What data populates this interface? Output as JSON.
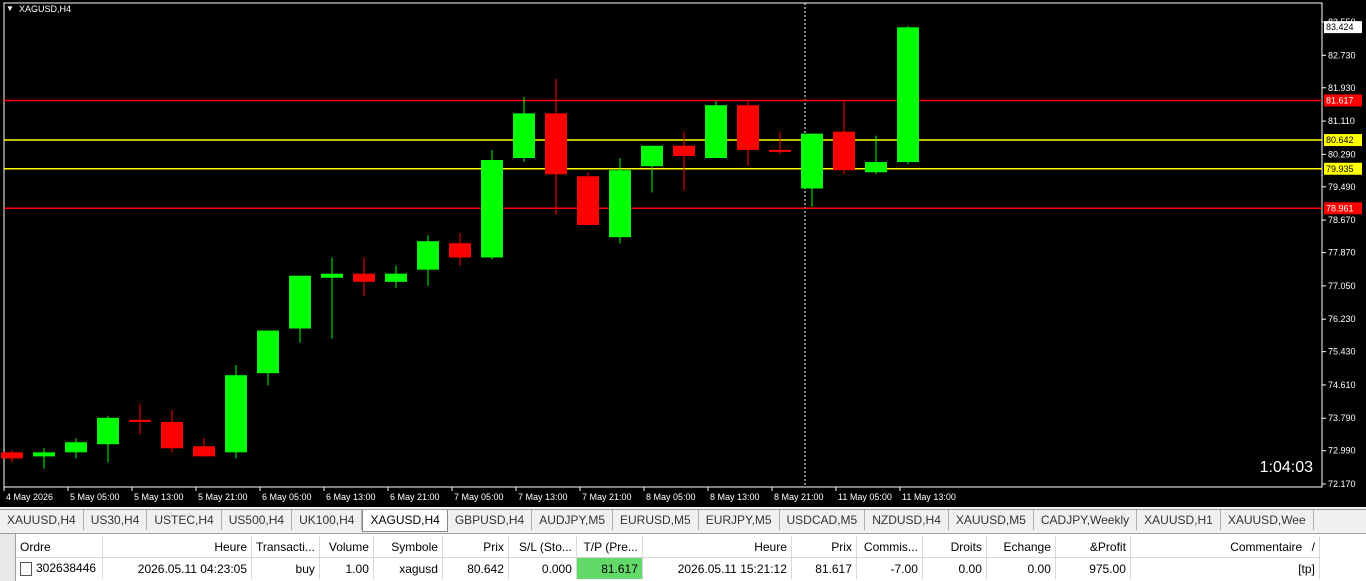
{
  "chart": {
    "title": "XAGUSD,H4",
    "countdown": "1:04:03",
    "price_labels": [
      "83.550",
      "83.424",
      "82.730",
      "81.930",
      "81.617",
      "81.110",
      "80.642",
      "80.290",
      "79.935",
      "79.490",
      "78.961",
      "78.670",
      "77.870",
      "77.050",
      "76.230",
      "75.430",
      "74.610",
      "73.790",
      "72.990",
      "72.170"
    ],
    "price_ticks": [
      83.55,
      82.73,
      81.93,
      81.11,
      80.29,
      79.49,
      78.67,
      77.87,
      77.05,
      76.23,
      75.43,
      74.61,
      73.79,
      72.99,
      72.17
    ],
    "current_price": 83.424,
    "time_labels": [
      "4 May 2026",
      "5 May 05:00",
      "5 May 13:00",
      "5 May 21:00",
      "6 May 05:00",
      "6 May 13:00",
      "6 May 21:00",
      "7 May 05:00",
      "7 May 13:00",
      "7 May 21:00",
      "8 May 05:00",
      "8 May 13:00",
      "8 May 21:00",
      "11 May 05:00",
      "11 May 13:00"
    ],
    "horizontal_lines": [
      {
        "price": 81.617,
        "label": "81.617",
        "color": "#ff0000",
        "label_bg": "#ff0000",
        "label_fg": "#ffffff"
      },
      {
        "price": 80.642,
        "label": "80.642",
        "color": "#ffff00",
        "label_bg": "#ffff00",
        "label_fg": "#000000"
      },
      {
        "price": 79.935,
        "label": "79.935",
        "color": "#ffff00",
        "label_bg": "#ffff00",
        "label_fg": "#000000"
      },
      {
        "price": 78.961,
        "label": "78.961",
        "color": "#ff0000",
        "label_bg": "#ff0000",
        "label_fg": "#ffffff"
      }
    ],
    "colors": {
      "bull": "#00ff00",
      "bear": "#ff0000",
      "background": "#000000",
      "axis": "#ffffff"
    }
  },
  "chart_data": {
    "type": "candlestick",
    "symbol": "XAGUSD",
    "timeframe": "H4",
    "ylim": [
      72.17,
      83.55
    ],
    "candles": [
      {
        "o": 72.95,
        "h": 73.0,
        "l": 72.7,
        "c": 72.8
      },
      {
        "o": 72.85,
        "h": 73.05,
        "l": 72.55,
        "c": 72.95
      },
      {
        "o": 72.95,
        "h": 73.3,
        "l": 72.8,
        "c": 73.2
      },
      {
        "o": 73.15,
        "h": 73.85,
        "l": 72.7,
        "c": 73.8
      },
      {
        "o": 73.75,
        "h": 74.15,
        "l": 73.4,
        "c": 73.7
      },
      {
        "o": 73.7,
        "h": 74.0,
        "l": 72.95,
        "c": 73.05
      },
      {
        "o": 73.1,
        "h": 73.3,
        "l": 72.85,
        "c": 72.85
      },
      {
        "o": 72.95,
        "h": 75.1,
        "l": 72.8,
        "c": 74.85
      },
      {
        "o": 74.9,
        "h": 75.95,
        "l": 74.6,
        "c": 75.95
      },
      {
        "o": 76.0,
        "h": 77.3,
        "l": 75.65,
        "c": 77.3
      },
      {
        "o": 77.25,
        "h": 77.75,
        "l": 75.75,
        "c": 77.35
      },
      {
        "o": 77.35,
        "h": 77.75,
        "l": 76.8,
        "c": 77.15
      },
      {
        "o": 77.15,
        "h": 77.55,
        "l": 77.0,
        "c": 77.35
      },
      {
        "o": 77.45,
        "h": 78.3,
        "l": 77.05,
        "c": 78.15
      },
      {
        "o": 78.1,
        "h": 78.35,
        "l": 77.55,
        "c": 77.75
      },
      {
        "o": 77.75,
        "h": 80.4,
        "l": 77.7,
        "c": 80.15
      },
      {
        "o": 80.2,
        "h": 81.7,
        "l": 80.1,
        "c": 81.3
      },
      {
        "o": 81.3,
        "h": 82.15,
        "l": 78.8,
        "c": 79.8
      },
      {
        "o": 79.75,
        "h": 79.85,
        "l": 78.55,
        "c": 78.55
      },
      {
        "o": 78.25,
        "h": 80.2,
        "l": 78.1,
        "c": 79.9
      },
      {
        "o": 80.0,
        "h": 80.5,
        "l": 79.35,
        "c": 80.5
      },
      {
        "o": 80.5,
        "h": 80.85,
        "l": 79.4,
        "c": 80.25
      },
      {
        "o": 80.2,
        "h": 81.6,
        "l": 80.2,
        "c": 81.5
      },
      {
        "o": 81.5,
        "h": 81.6,
        "l": 80.0,
        "c": 80.4
      },
      {
        "o": 80.4,
        "h": 80.85,
        "l": 80.3,
        "c": 80.35
      },
      {
        "o": 79.45,
        "h": 80.8,
        "l": 79.0,
        "c": 80.8
      },
      {
        "o": 80.85,
        "h": 81.6,
        "l": 79.8,
        "c": 79.9
      },
      {
        "o": 79.85,
        "h": 80.75,
        "l": 79.8,
        "c": 80.1
      },
      {
        "o": 80.1,
        "h": 83.45,
        "l": 80.05,
        "c": 83.42
      }
    ]
  },
  "tabs": [
    {
      "label": "XAUUSD,H4"
    },
    {
      "label": "US30,H4"
    },
    {
      "label": "USTEC,H4"
    },
    {
      "label": "US500,H4"
    },
    {
      "label": "UK100,H4"
    },
    {
      "label": "XAGUSD,H4",
      "active": true
    },
    {
      "label": "GBPUSD,H4"
    },
    {
      "label": "AUDJPY,M5"
    },
    {
      "label": "EURUSD,M5"
    },
    {
      "label": "EURJPY,M5"
    },
    {
      "label": "USDCAD,M5"
    },
    {
      "label": "NZDUSD,H4"
    },
    {
      "label": "XAUUSD,M5"
    },
    {
      "label": "CADJPY,Weekly"
    },
    {
      "label": "XAUUSD,H1"
    },
    {
      "label": "XAUUSD,Wee"
    }
  ],
  "terminal": {
    "side_label": "inal",
    "headers": {
      "ordre": "Ordre",
      "heure": "Heure",
      "transaction": "Transacti...",
      "volume": "Volume",
      "symbole": "Symbole",
      "prix": "Prix",
      "sl": "S/L (Sto...",
      "tp": "T/P (Pre...",
      "heure2": "Heure",
      "prix2": "Prix",
      "commission": "Commis...",
      "droits": "Droits",
      "echange": "Echange",
      "profit": "&Profit",
      "commentaire": "Commentaire",
      "sort_arrow": "/"
    },
    "row": {
      "ordre": "302638446",
      "heure": "2026.05.11 04:23:05",
      "transaction": "buy",
      "volume": "1.00",
      "symbole": "xagusd",
      "prix": "80.642",
      "sl": "0.000",
      "tp": "81.617",
      "heure2": "2026.05.11 15:21:12",
      "prix2": "81.617",
      "commission": "-7.00",
      "droits": "0.00",
      "echange": "0.00",
      "profit": "975.00",
      "commentaire": "[tp]"
    },
    "tp_highlight_color": "#63d96a"
  }
}
